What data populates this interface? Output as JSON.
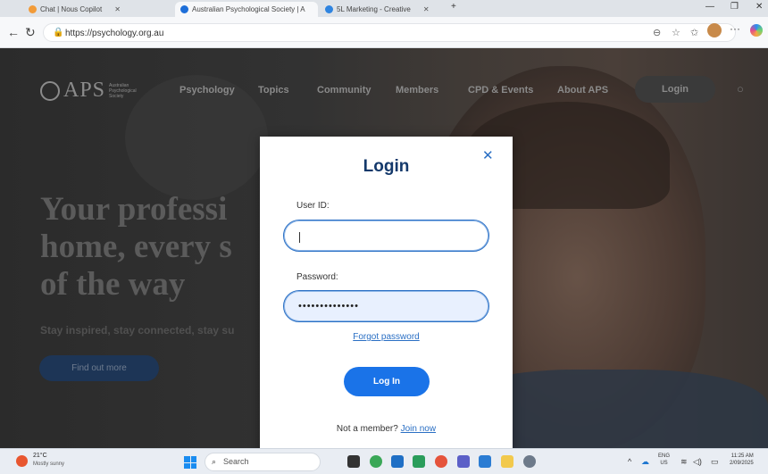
{
  "browser": {
    "tabs": [
      {
        "title": "Chat | Nous Copilot",
        "favicon_color": "#f29b38"
      },
      {
        "title": "Australian Psychological Society | A",
        "favicon_color": "#1e6fd9"
      },
      {
        "title": "5L Marketing - Creative",
        "favicon_color": "#2f84e0"
      }
    ],
    "new_tab": "+",
    "url": "https://psychology.org.au",
    "window_controls": {
      "minimize": "—",
      "restore": "❐",
      "close": "✕"
    },
    "toolbar_more": "···"
  },
  "site": {
    "logo_text": "APS",
    "logo_subtext": "Australian Psychological Society",
    "nav": [
      "Psychology",
      "Topics",
      "Community",
      "Members",
      "CPD & Events",
      "About APS"
    ],
    "login_label": "Login",
    "hero_title_lines": [
      "Your professi",
      "home, every s",
      "of the way"
    ],
    "hero_sub": "Stay inspired, stay connected, stay su",
    "hero_button": "Find out more"
  },
  "modal": {
    "title": "Login",
    "close": "✕",
    "user_id_label": "User ID:",
    "user_id_value": "",
    "password_label": "Password:",
    "password_value": "••••••••••••••",
    "forgot_password": "Forgot password",
    "login_button": "Log In",
    "member_text": "Not a member?",
    "join_link": "Join now"
  },
  "taskbar": {
    "weather_temp": "21°C",
    "weather_desc": "Mostly sunny",
    "search_placeholder": "Search",
    "lang_top": "ENG",
    "lang_bottom": "US",
    "time": "11:25 AM",
    "date": "2/09/2025"
  }
}
